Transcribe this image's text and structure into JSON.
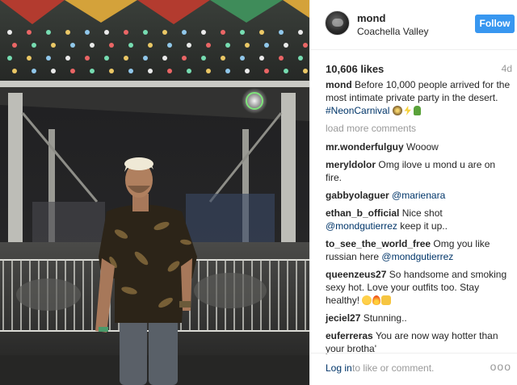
{
  "post": {
    "username": "mond",
    "location": "Coachella Valley",
    "follow_label": "Follow",
    "likes": "10,606 likes",
    "time": "4d"
  },
  "caption": {
    "user": "mond",
    "text": "Before 10,000 people arrived for the most intimate private party in the desert.",
    "hashtag": "#NeonCarnival"
  },
  "load_more": "load more comments",
  "comments": [
    {
      "user": "mr.wonderfulguy",
      "text": "Wooow"
    },
    {
      "user": "meryldolor",
      "text": "Omg ilove u mond u are on fire."
    },
    {
      "user": "gabbyolaguer",
      "text": "",
      "mention": "@marienara"
    },
    {
      "user": "ethan_b_official",
      "text": "Nice shot",
      "mention": "@mondgutierrez",
      "text_after": "keep it up.."
    },
    {
      "user": "to_see_the_world_free",
      "text": "Omg you like russian here",
      "mention": "@mondgutierrez"
    },
    {
      "user": "queenzeus27",
      "text": "So handsome and smoking sexy hot. Love your outfits too. Stay healthy!"
    },
    {
      "user": "jeciel27",
      "text": "Stunning.."
    },
    {
      "user": "euferreras",
      "text": "You are now way hotter than your brotha'"
    }
  ],
  "footer": {
    "login_link": "Log in",
    "login_rest": "to like or comment.",
    "more": "ooo"
  },
  "icons": {
    "caption_emojis": [
      "sparkler-icon",
      "lightning-icon",
      "cactus-icon"
    ],
    "queen_emojis": [
      "heart-eyes-icon",
      "fire-icon",
      "thumbs-up-icon"
    ]
  },
  "colors": {
    "follow_button": "#3897f0",
    "link": "#003569",
    "muted": "#999999"
  }
}
